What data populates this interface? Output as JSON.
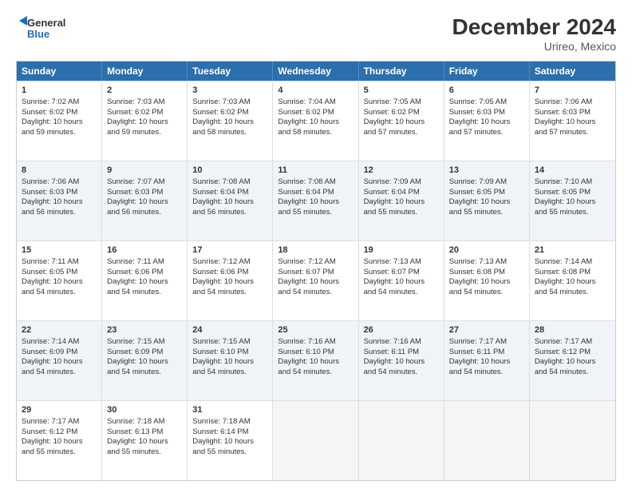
{
  "logo": {
    "line1": "General",
    "line2": "Blue"
  },
  "title": "December 2024",
  "subtitle": "Urireo, Mexico",
  "header_days": [
    "Sunday",
    "Monday",
    "Tuesday",
    "Wednesday",
    "Thursday",
    "Friday",
    "Saturday"
  ],
  "rows": [
    {
      "alt": false,
      "cells": [
        {
          "day": "1",
          "lines": [
            "Sunrise: 7:02 AM",
            "Sunset: 6:02 PM",
            "Daylight: 10 hours",
            "and 59 minutes."
          ]
        },
        {
          "day": "2",
          "lines": [
            "Sunrise: 7:03 AM",
            "Sunset: 6:02 PM",
            "Daylight: 10 hours",
            "and 59 minutes."
          ]
        },
        {
          "day": "3",
          "lines": [
            "Sunrise: 7:03 AM",
            "Sunset: 6:02 PM",
            "Daylight: 10 hours",
            "and 58 minutes."
          ]
        },
        {
          "day": "4",
          "lines": [
            "Sunrise: 7:04 AM",
            "Sunset: 6:02 PM",
            "Daylight: 10 hours",
            "and 58 minutes."
          ]
        },
        {
          "day": "5",
          "lines": [
            "Sunrise: 7:05 AM",
            "Sunset: 6:02 PM",
            "Daylight: 10 hours",
            "and 57 minutes."
          ]
        },
        {
          "day": "6",
          "lines": [
            "Sunrise: 7:05 AM",
            "Sunset: 6:03 PM",
            "Daylight: 10 hours",
            "and 57 minutes."
          ]
        },
        {
          "day": "7",
          "lines": [
            "Sunrise: 7:06 AM",
            "Sunset: 6:03 PM",
            "Daylight: 10 hours",
            "and 57 minutes."
          ]
        }
      ]
    },
    {
      "alt": true,
      "cells": [
        {
          "day": "8",
          "lines": [
            "Sunrise: 7:06 AM",
            "Sunset: 6:03 PM",
            "Daylight: 10 hours",
            "and 56 minutes."
          ]
        },
        {
          "day": "9",
          "lines": [
            "Sunrise: 7:07 AM",
            "Sunset: 6:03 PM",
            "Daylight: 10 hours",
            "and 56 minutes."
          ]
        },
        {
          "day": "10",
          "lines": [
            "Sunrise: 7:08 AM",
            "Sunset: 6:04 PM",
            "Daylight: 10 hours",
            "and 56 minutes."
          ]
        },
        {
          "day": "11",
          "lines": [
            "Sunrise: 7:08 AM",
            "Sunset: 6:04 PM",
            "Daylight: 10 hours",
            "and 55 minutes."
          ]
        },
        {
          "day": "12",
          "lines": [
            "Sunrise: 7:09 AM",
            "Sunset: 6:04 PM",
            "Daylight: 10 hours",
            "and 55 minutes."
          ]
        },
        {
          "day": "13",
          "lines": [
            "Sunrise: 7:09 AM",
            "Sunset: 6:05 PM",
            "Daylight: 10 hours",
            "and 55 minutes."
          ]
        },
        {
          "day": "14",
          "lines": [
            "Sunrise: 7:10 AM",
            "Sunset: 6:05 PM",
            "Daylight: 10 hours",
            "and 55 minutes."
          ]
        }
      ]
    },
    {
      "alt": false,
      "cells": [
        {
          "day": "15",
          "lines": [
            "Sunrise: 7:11 AM",
            "Sunset: 6:05 PM",
            "Daylight: 10 hours",
            "and 54 minutes."
          ]
        },
        {
          "day": "16",
          "lines": [
            "Sunrise: 7:11 AM",
            "Sunset: 6:06 PM",
            "Daylight: 10 hours",
            "and 54 minutes."
          ]
        },
        {
          "day": "17",
          "lines": [
            "Sunrise: 7:12 AM",
            "Sunset: 6:06 PM",
            "Daylight: 10 hours",
            "and 54 minutes."
          ]
        },
        {
          "day": "18",
          "lines": [
            "Sunrise: 7:12 AM",
            "Sunset: 6:07 PM",
            "Daylight: 10 hours",
            "and 54 minutes."
          ]
        },
        {
          "day": "19",
          "lines": [
            "Sunrise: 7:13 AM",
            "Sunset: 6:07 PM",
            "Daylight: 10 hours",
            "and 54 minutes."
          ]
        },
        {
          "day": "20",
          "lines": [
            "Sunrise: 7:13 AM",
            "Sunset: 6:08 PM",
            "Daylight: 10 hours",
            "and 54 minutes."
          ]
        },
        {
          "day": "21",
          "lines": [
            "Sunrise: 7:14 AM",
            "Sunset: 6:08 PM",
            "Daylight: 10 hours",
            "and 54 minutes."
          ]
        }
      ]
    },
    {
      "alt": true,
      "cells": [
        {
          "day": "22",
          "lines": [
            "Sunrise: 7:14 AM",
            "Sunset: 6:09 PM",
            "Daylight: 10 hours",
            "and 54 minutes."
          ]
        },
        {
          "day": "23",
          "lines": [
            "Sunrise: 7:15 AM",
            "Sunset: 6:09 PM",
            "Daylight: 10 hours",
            "and 54 minutes."
          ]
        },
        {
          "day": "24",
          "lines": [
            "Sunrise: 7:15 AM",
            "Sunset: 6:10 PM",
            "Daylight: 10 hours",
            "and 54 minutes."
          ]
        },
        {
          "day": "25",
          "lines": [
            "Sunrise: 7:16 AM",
            "Sunset: 6:10 PM",
            "Daylight: 10 hours",
            "and 54 minutes."
          ]
        },
        {
          "day": "26",
          "lines": [
            "Sunrise: 7:16 AM",
            "Sunset: 6:11 PM",
            "Daylight: 10 hours",
            "and 54 minutes."
          ]
        },
        {
          "day": "27",
          "lines": [
            "Sunrise: 7:17 AM",
            "Sunset: 6:11 PM",
            "Daylight: 10 hours",
            "and 54 minutes."
          ]
        },
        {
          "day": "28",
          "lines": [
            "Sunrise: 7:17 AM",
            "Sunset: 6:12 PM",
            "Daylight: 10 hours",
            "and 54 minutes."
          ]
        }
      ]
    },
    {
      "alt": false,
      "cells": [
        {
          "day": "29",
          "lines": [
            "Sunrise: 7:17 AM",
            "Sunset: 6:12 PM",
            "Daylight: 10 hours",
            "and 55 minutes."
          ]
        },
        {
          "day": "30",
          "lines": [
            "Sunrise: 7:18 AM",
            "Sunset: 6:13 PM",
            "Daylight: 10 hours",
            "and 55 minutes."
          ]
        },
        {
          "day": "31",
          "lines": [
            "Sunrise: 7:18 AM",
            "Sunset: 6:14 PM",
            "Daylight: 10 hours",
            "and 55 minutes."
          ]
        },
        {
          "day": "",
          "lines": []
        },
        {
          "day": "",
          "lines": []
        },
        {
          "day": "",
          "lines": []
        },
        {
          "day": "",
          "lines": []
        }
      ]
    }
  ]
}
